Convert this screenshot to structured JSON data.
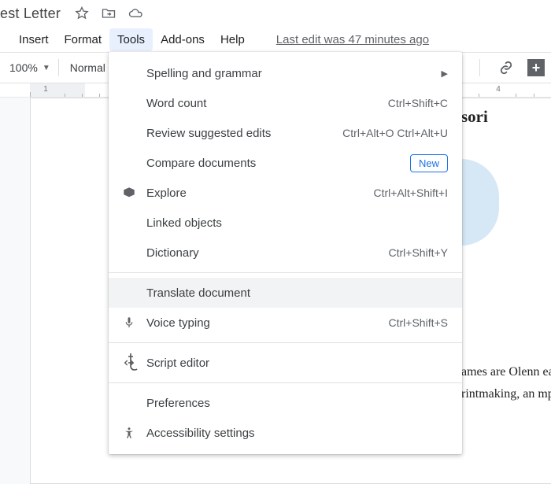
{
  "title": "est Letter",
  "menubar": {
    "insert": "Insert",
    "format": "Format",
    "tools": "Tools",
    "addons": "Add-ons",
    "help": "Help",
    "last_edit": "Last edit was 47 minutes ago"
  },
  "toolbar": {
    "zoom": "100%",
    "style": "Normal"
  },
  "ruler": {
    "n1": "1",
    "n4": "4"
  },
  "doc": {
    "heading": "sori",
    "body": "ames are Olenn ear in a row. Th in mediums th rintmaking, an mpresses all of"
  },
  "tools_menu": {
    "spelling": "Spelling and grammar",
    "wordcount": {
      "label": "Word count",
      "accel": "Ctrl+Shift+C"
    },
    "review": {
      "label": "Review suggested edits",
      "accel": "Ctrl+Alt+O Ctrl+Alt+U"
    },
    "compare": {
      "label": "Compare documents",
      "badge": "New"
    },
    "explore": {
      "label": "Explore",
      "accel": "Ctrl+Alt+Shift+I"
    },
    "linked": "Linked objects",
    "dictionary": {
      "label": "Dictionary",
      "accel": "Ctrl+Shift+Y"
    },
    "translate": "Translate document",
    "voice": {
      "label": "Voice typing",
      "accel": "Ctrl+Shift+S"
    },
    "script": "Script editor",
    "prefs": "Preferences",
    "a11y": "Accessibility settings"
  }
}
